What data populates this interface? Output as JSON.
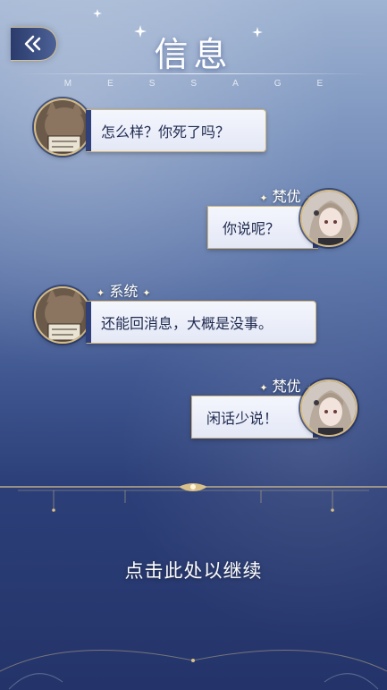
{
  "header": {
    "title": "信息",
    "subtitle": "MESSAGE",
    "back_icon": "back-arrow-icon"
  },
  "messages": [
    {
      "speaker": "",
      "side": "left",
      "text": "怎么样？你死了吗？",
      "avatar": "cat-with-sign-avatar"
    },
    {
      "speaker": "梵优",
      "side": "right",
      "text": "你说呢？",
      "avatar": "girl-portrait-avatar"
    },
    {
      "speaker": "系统",
      "side": "left",
      "text": "还能回消息，大概是没事。",
      "avatar": "cat-with-sign-avatar"
    },
    {
      "speaker": "梵优",
      "side": "right",
      "text": "闲话少说！",
      "avatar": "girl-portrait-avatar"
    }
  ],
  "footer": {
    "continue_text": "点击此处以继续"
  },
  "colors": {
    "accent_gold": "#d6bb82",
    "bubble_bg": "#eef1fa",
    "bubble_edge": "#2f3f7a"
  }
}
